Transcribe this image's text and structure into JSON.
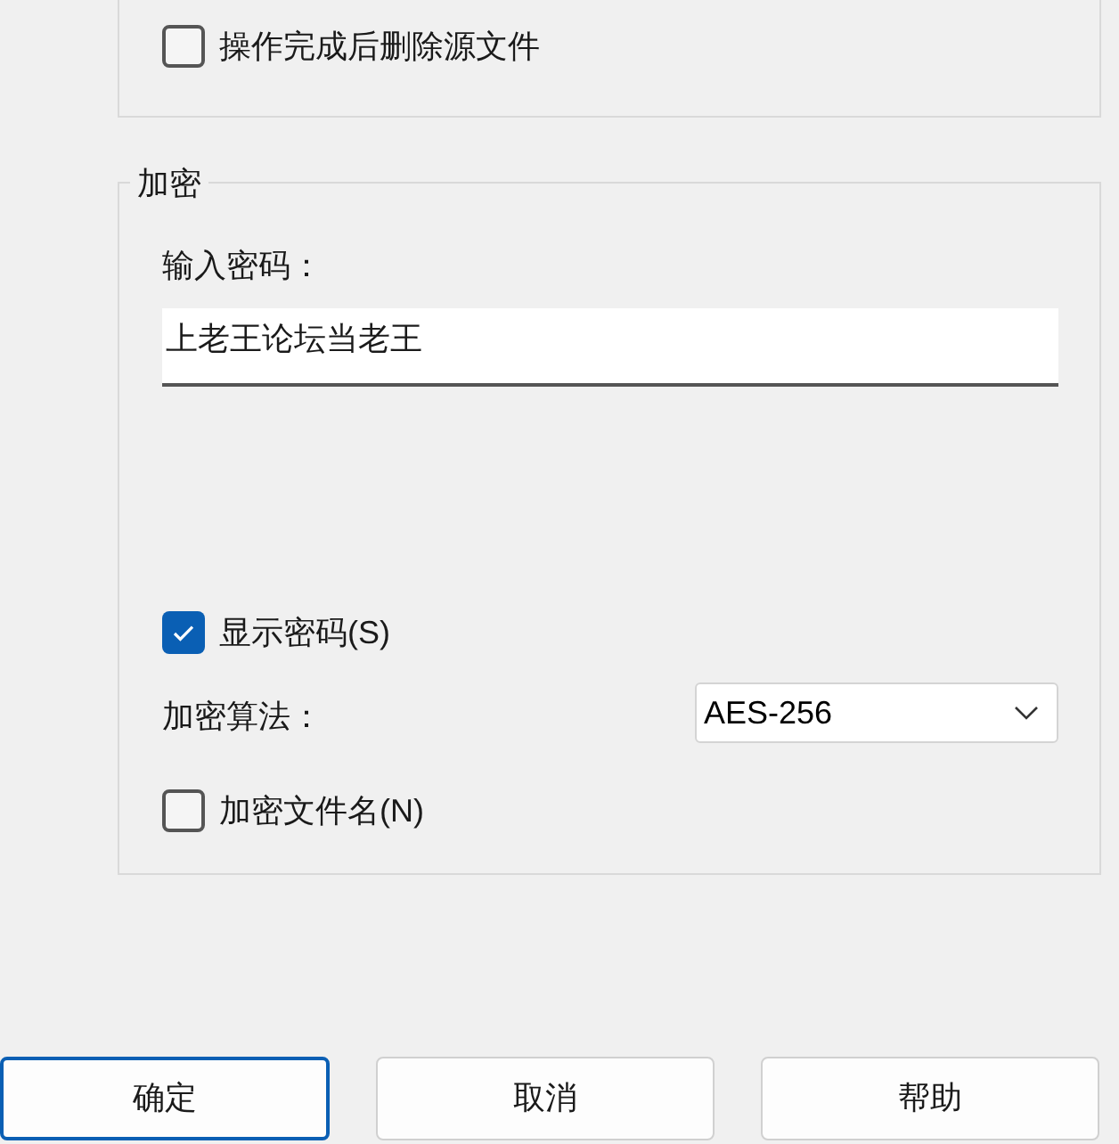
{
  "options_group": {
    "checkboxes": [
      {
        "label": "操作完成后删除源文件",
        "checked": false
      }
    ]
  },
  "encryption_group": {
    "title": "加密",
    "password_label": "输入密码：",
    "password_value": "上老王论坛当老王",
    "show_password": {
      "label": "显示密码(S)",
      "checked": true
    },
    "algorithm_label": "加密算法：",
    "algorithm_value": "AES-256",
    "encrypt_filenames": {
      "label": "加密文件名(N)",
      "checked": false
    }
  },
  "buttons": [
    {
      "label": "确定",
      "focused": true
    },
    {
      "label": "取消",
      "focused": false
    },
    {
      "label": "帮助",
      "focused": false
    }
  ]
}
